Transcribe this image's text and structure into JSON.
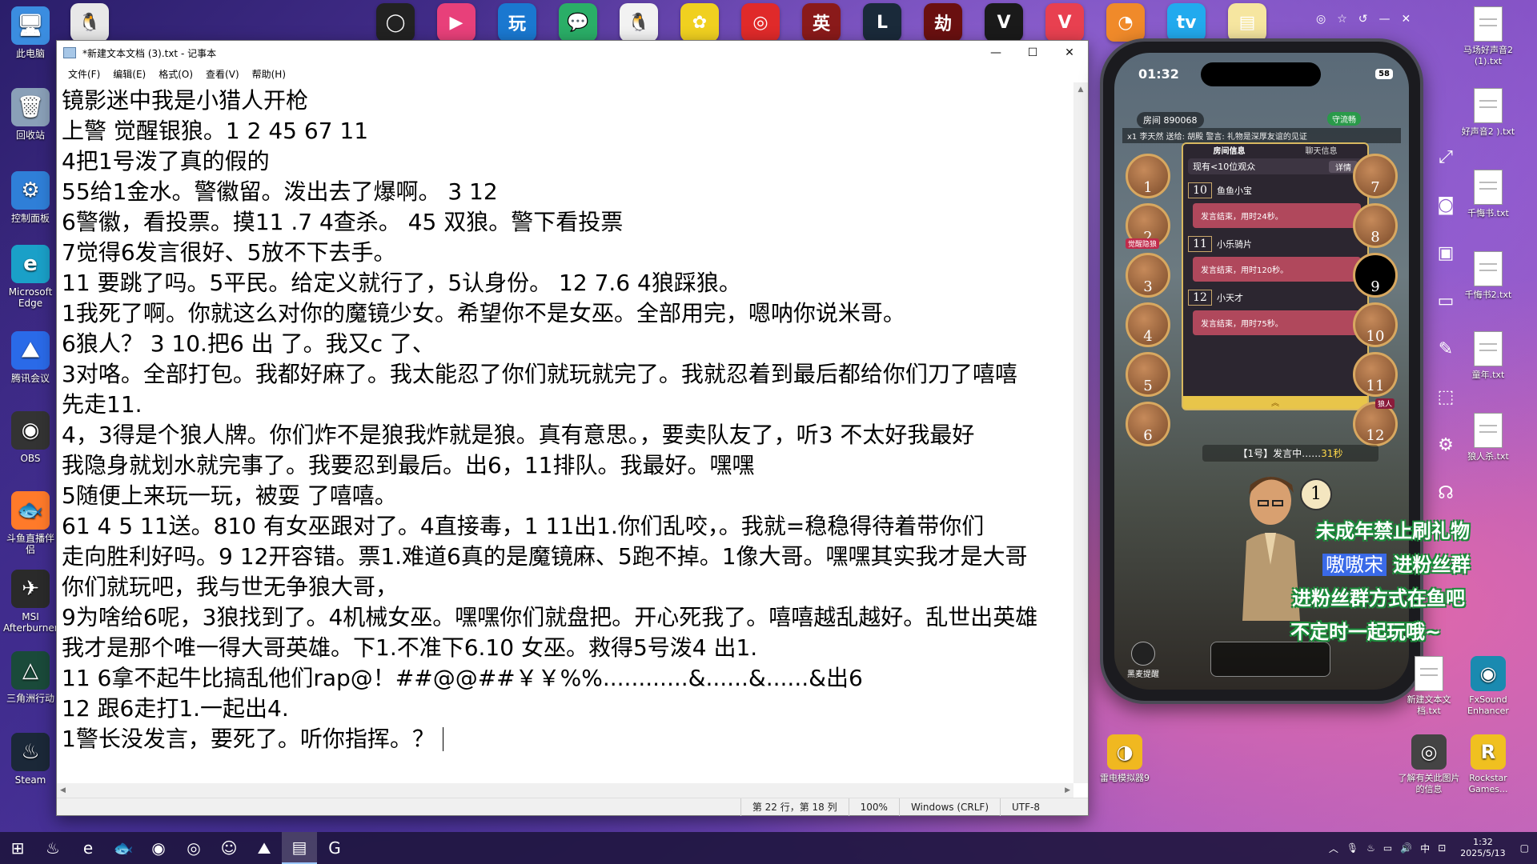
{
  "desktop_left": [
    {
      "label": "此电脑",
      "icon": "computer-icon",
      "color": "#3b8de0",
      "glyph": "🖥"
    },
    {
      "label": "回收站",
      "icon": "recycle-bin-icon",
      "color": "#8aa0b8",
      "glyph": "🗑"
    },
    {
      "label": "控制面板",
      "icon": "control-panel-icon",
      "color": "#2f7fd8",
      "glyph": "⚙"
    },
    {
      "label": "Microsoft Edge",
      "icon": "edge-icon",
      "color": "#1aa0c8",
      "glyph": "e"
    },
    {
      "label": "腾讯会议",
      "icon": "tencent-meeting-icon",
      "color": "#2a6ae8",
      "glyph": "⛰"
    },
    {
      "label": "OBS",
      "icon": "obs-icon",
      "color": "#333333",
      "glyph": "◉"
    },
    {
      "label": "斗鱼直播伴侣",
      "icon": "douyu-icon",
      "color": "#ff7a2a",
      "glyph": "🐟"
    },
    {
      "label": "MSI Afterburner",
      "icon": "msi-afterburner-icon",
      "color": "#2a2a2a",
      "glyph": "✈"
    },
    {
      "label": "三角洲行动",
      "icon": "delta-force-icon",
      "color": "#1a4a3a",
      "glyph": "△"
    },
    {
      "label": "Steam",
      "icon": "steam-icon",
      "color": "#1b2838",
      "glyph": "♨"
    }
  ],
  "top_apps": [
    {
      "icon": "qq-icon",
      "color": "#e8e8e8",
      "glyph": "🐧"
    },
    {
      "icon": "yellow-circle-app-icon",
      "color": "#222222",
      "glyph": "◯"
    },
    {
      "icon": "pink-arrow-app-icon",
      "color": "#e8407a",
      "glyph": "▶"
    },
    {
      "icon": "beta-app-icon",
      "color": "#1a78d0",
      "glyph": "玩"
    },
    {
      "icon": "wechat-icon",
      "color": "#2aae67",
      "glyph": "💬"
    },
    {
      "icon": "qq-penguin-icon",
      "color": "#f2f2f2",
      "glyph": "🐧"
    },
    {
      "icon": "leaf-app-icon",
      "color": "#f0d020",
      "glyph": "✿"
    },
    {
      "icon": "netease-music-icon",
      "color": "#e02a2a",
      "glyph": "◎"
    },
    {
      "icon": "game-badge-icon",
      "color": "#8a1a1a",
      "glyph": "英"
    },
    {
      "icon": "league-icon",
      "color": "#1a2a3a",
      "glyph": "L"
    },
    {
      "icon": "naraka-icon",
      "color": "#6a1010",
      "glyph": "劫"
    },
    {
      "icon": "valorant-wings-icon",
      "color": "#1a1a1a",
      "glyph": "V"
    },
    {
      "icon": "valorant-icon",
      "color": "#e84050",
      "glyph": "V"
    },
    {
      "icon": "orange-app-icon",
      "color": "#f08a2a",
      "glyph": "◔"
    },
    {
      "icon": "bilibili-icon",
      "color": "#22aaee",
      "glyph": "tv"
    },
    {
      "icon": "file-icon",
      "color": "#f6e6a0",
      "glyph": "▤"
    }
  ],
  "notepad": {
    "title": "*新建文本文档 (3).txt - 记事本",
    "menu": [
      "文件(F)",
      "编辑(E)",
      "格式(O)",
      "查看(V)",
      "帮助(H)"
    ],
    "lines": [
      "镜影迷中我是小猎人开枪",
      "上警 觉醒银狼。1 2 45 67 11",
      "4把1号泼了真的假的",
      "55给1金水。警徽留。泼出去了爆啊。 3 12",
      "6警徽，看投票。摸11 .7 4查杀。 45 双狼。警下看投票",
      "7觉得6发言很好、5放不下去手。",
      "11 要跳了吗。5平民。给定义就行了，5认身份。 12 7.6 4狼踩狼。",
      "1我死了啊。你就这么对你的魔镜少女。希望你不是女巫。全部用完，嗯呐你说米哥。",
      "6狼人？ 3 10.把6 出 了。我又c 了、",
      "3对咯。全部打包。我都好麻了。我太能忍了你们就玩就完了。我就忍着到最后都给你们刀了嘻嘻",
      "先走11.",
      "4，3得是个狼人牌。你们炸不是狼我炸就是狼。真有意思。，要卖队友了，听3 不太好我最好",
      "我隐身就划水就完事了。我要忍到最后。出6，11排队。我最好。嘿嘿",
      "5随便上来玩一玩，被耍 了嘻嘻。",
      "61 4 5 11送。810 有女巫跟对了。4直接毒，1 11出1.你们乱咬，。我就=稳稳得待着带你们",
      "走向胜利好吗。9 12开容错。票1.难道6真的是魔镜麻、5跑不掉。1像大哥。嘿嘿其实我才是大哥",
      "你们就玩吧，我与世无争狼大哥，",
      "9为啥给6呢，3狼找到了。4机械女巫。嘿嘿你们就盘把。开心死我了。嘻嘻越乱越好。乱世出英雄",
      "我才是那个唯一得大哥英雄。下1.不准下6.10 女巫。救得5号泼4 出1.",
      "11 6拿不起牛比搞乱他们rap@！##@@##￥￥%%............&......&......&出6",
      "12 跟6走打1.一起出4.",
      "1警长没发言，要死了。听你指挥。？"
    ],
    "status": {
      "position": "第 22 行，第 18 列",
      "zoom": "100%",
      "line_ending": "Windows (CRLF)",
      "encoding": "UTF-8"
    }
  },
  "phone": {
    "time": "01:32",
    "battery": "58",
    "room_id": "房间 890068",
    "flow": "守流畅",
    "room_msg": "x1  李天然  送给:  胡殿   警言: 礼物是深厚友谊的见证",
    "tabs": [
      "房间信息",
      "聊天信息"
    ],
    "viewers": "现有<10位观众",
    "detail": "详情",
    "speeches": [
      {
        "num": "10",
        "name": "鱼鱼小宝",
        "text": "发言结束，用时24秒。"
      },
      {
        "num": "11",
        "name": "小乐骑片",
        "text": "发言结束，用时120秒。"
      },
      {
        "num": "12",
        "name": "小天才",
        "text": "发言结束，用时75秒。"
      }
    ],
    "seats_left": [
      "1",
      "2",
      "3",
      "4",
      "5",
      "6"
    ],
    "seats_right": [
      "7",
      "8",
      "9",
      "10",
      "11",
      "12"
    ],
    "speaking_label": "【1号】发言中……",
    "speaking_time": "31秒",
    "current_speaker": "1",
    "mic_label": "黑麦提醒",
    "badge_wolf": "狼人",
    "badge_awaken": "觉醒隐狼"
  },
  "overlay": {
    "line1": "未成年禁止刷礼物",
    "line2_hi": "嗷嗷宋",
    "line2": "进粉丝群",
    "line3": "进粉丝群方式在鱼吧",
    "line4": "不定时一起玩哦~"
  },
  "desktop_right": [
    {
      "label": "马场好声音2 (1).txt"
    },
    {
      "label": "好声音2 ).txt"
    },
    {
      "label": "千悔书.txt"
    },
    {
      "label": "千悔书2.txt"
    },
    {
      "label": "童年.txt"
    },
    {
      "label": "狼人杀.txt"
    }
  ],
  "desktop_bottom_right": [
    {
      "label": "新建文本文 档.txt"
    },
    {
      "label": "FxSound Enhancer"
    },
    {
      "label": "雷电模拟器9"
    },
    {
      "label": "了解有关此图片的信息"
    },
    {
      "label": "Rockstar Games..."
    }
  ],
  "taskbar": {
    "items": [
      {
        "icon": "windows-start-icon",
        "glyph": "⊞"
      },
      {
        "icon": "steam-taskbar-icon",
        "glyph": "♨"
      },
      {
        "icon": "edge-taskbar-icon",
        "glyph": "e"
      },
      {
        "icon": "douyu-taskbar-icon",
        "glyph": "🐟"
      },
      {
        "icon": "obs-taskbar-icon",
        "glyph": "◉"
      },
      {
        "icon": "netease-taskbar-icon",
        "glyph": "◎"
      },
      {
        "icon": "game-taskbar-icon",
        "glyph": "☺"
      },
      {
        "icon": "meeting-taskbar-icon",
        "glyph": "⛰"
      },
      {
        "icon": "notepad-taskbar-icon",
        "glyph": "▤",
        "active": true
      },
      {
        "icon": "app-taskbar-icon",
        "glyph": "G"
      }
    ],
    "tray_lang": "中",
    "time": "1:32",
    "date": "2025/5/13"
  }
}
